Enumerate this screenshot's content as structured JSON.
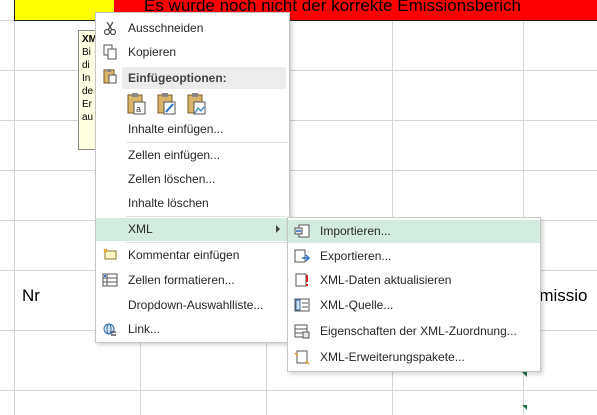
{
  "sheet": {
    "red_header_text": "Es wurde noch nicht der korrekte Emissionsberich",
    "comment_lines": [
      "XM",
      "Bi",
      "di",
      "In",
      "de",
      "Er",
      "au"
    ],
    "cell_nr": "Nr",
    "cell_emission": "Emissio"
  },
  "context_menu": {
    "items": [
      {
        "label": "Ausschneiden",
        "icon": "scissors-icon"
      },
      {
        "label": "Kopieren",
        "icon": "copy-icon"
      },
      {
        "label": "Einfügeoptionen:",
        "icon": "paste-icon"
      },
      {
        "label": "Inhalte einfügen...",
        "icon": ""
      },
      {
        "label": "Zellen einfügen...",
        "icon": ""
      },
      {
        "label": "Zellen löschen...",
        "icon": ""
      },
      {
        "label": "Inhalte löschen",
        "icon": ""
      },
      {
        "label": "XML",
        "icon": ""
      },
      {
        "label": "Kommentar einfügen",
        "icon": "new-comment-icon"
      },
      {
        "label": "Zellen formatieren...",
        "icon": "format-cells-icon"
      },
      {
        "label": "Dropdown-Auswahlliste...",
        "icon": ""
      },
      {
        "label": "Link...",
        "icon": "link-icon"
      }
    ],
    "paste_options": [
      "paste-values-icon",
      "paste-formatting-icon",
      "paste-picture-icon"
    ]
  },
  "xml_submenu": {
    "items": [
      {
        "label": "Importieren...",
        "icon": "xml-import-icon"
      },
      {
        "label": "Exportieren...",
        "icon": "xml-export-icon"
      },
      {
        "label": "XML-Daten aktualisieren",
        "icon": "xml-refresh-icon"
      },
      {
        "label": "XML-Quelle...",
        "icon": "xml-source-icon"
      },
      {
        "label": "Eigenschaften der XML-Zuordnung...",
        "icon": "xml-map-properties-icon"
      },
      {
        "label": "XML-Erweiterungspakete...",
        "icon": "xml-expansion-packs-icon"
      }
    ]
  },
  "colors": {
    "highlight": "#d4ebe0",
    "header_red": "#ff0000",
    "header_yellow": "#ffff00"
  }
}
